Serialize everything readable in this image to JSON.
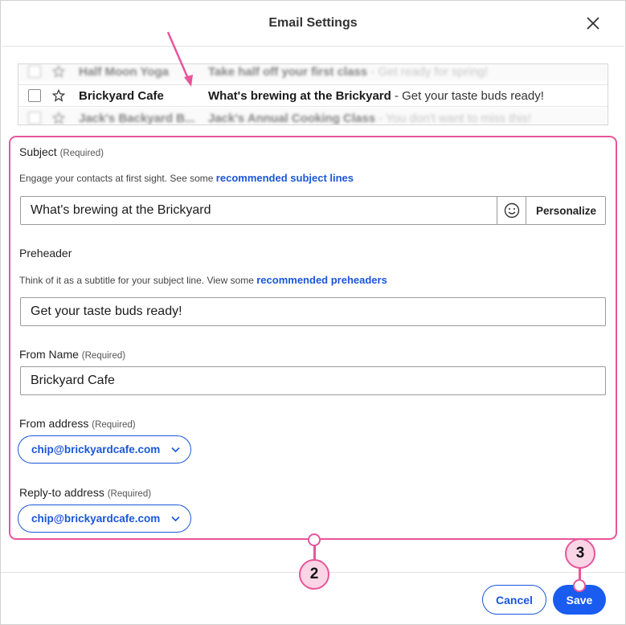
{
  "dialog": {
    "title": "Email Settings"
  },
  "inbox_preview": {
    "rows": [
      {
        "sender": "Half Moon Yoga",
        "subject": "Take half off your first class",
        "preheader": " - Get ready for spring!"
      },
      {
        "sender": "Brickyard Cafe",
        "subject": "What's brewing at the Brickyard",
        "preheader": " - Get your taste buds ready!"
      },
      {
        "sender": "Jack's Backyard B...",
        "subject": "Jack's Annual Cooking Class",
        "preheader": " - You don't want to miss this!"
      }
    ]
  },
  "form": {
    "subject": {
      "label": "Subject",
      "required": "(Required)",
      "hint": "Engage your contacts at first sight. See some ",
      "hint_link": "recommended subject lines",
      "value": "What's brewing at the Brickyard",
      "personalize_label": "Personalize"
    },
    "preheader": {
      "label": "Preheader",
      "hint": "Think of it as a subtitle for your subject line. View some ",
      "hint_link": "recommended preheaders",
      "value": "Get your taste buds ready!"
    },
    "from_name": {
      "label": "From Name",
      "required": "(Required)",
      "value": "Brickyard Cafe"
    },
    "from_address": {
      "label": "From address",
      "required": "(Required)",
      "selected": "chip@brickyardcafe.com"
    },
    "reply_to": {
      "label": "Reply-to address",
      "required": "(Required)",
      "selected": "chip@brickyardcafe.com"
    }
  },
  "footer": {
    "cancel_label": "Cancel",
    "save_label": "Save"
  },
  "callouts": {
    "form_step": "2",
    "save_step": "3"
  },
  "colors": {
    "accent": "#1a56db",
    "annotation": "#e8559a"
  }
}
